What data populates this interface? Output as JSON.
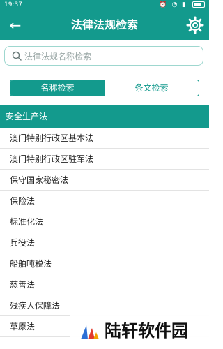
{
  "status_bar": {
    "time": "19:37",
    "icons": [
      "alarm-icon",
      "wifi-icon",
      "signal-icon",
      "battery-icon"
    ]
  },
  "toolbar": {
    "title": "法律法规检索",
    "back_icon": "back-arrow-icon",
    "settings_icon": "gear-icon"
  },
  "search": {
    "placeholder": "法律法规名称检索",
    "value": ""
  },
  "tabs": [
    {
      "label": "名称检索",
      "active": true
    },
    {
      "label": "条文检索",
      "active": false
    }
  ],
  "section": {
    "title": "安全生产法"
  },
  "laws": [
    "澳门特别行政区基本法",
    "澳门特别行政区驻军法",
    "保守国家秘密法",
    "保险法",
    "标准化法",
    "兵役法",
    "船舶吨税法",
    "慈善法",
    "残疾人保障法",
    "草原法"
  ],
  "watermark": {
    "text": "陆轩软件园"
  },
  "colors": {
    "primary": "#139a8d",
    "divider": "#e3e3e3",
    "search_border": "#9ed7cf"
  }
}
